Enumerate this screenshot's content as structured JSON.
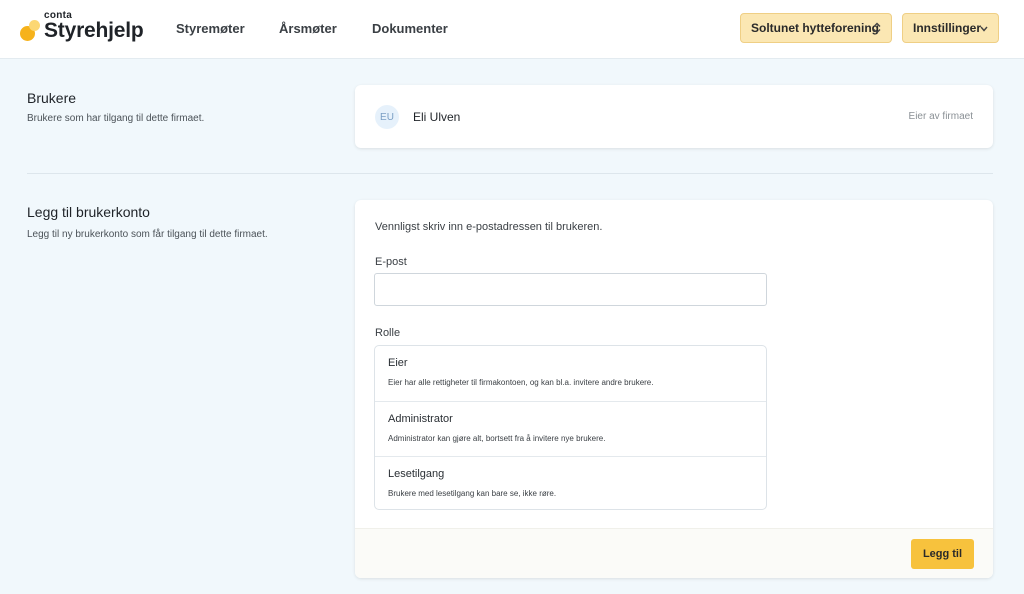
{
  "header": {
    "logo_small": "conta",
    "logo_big": "Styrehjelp",
    "nav": [
      "Styremøter",
      "Årsmøter",
      "Dokumenter"
    ],
    "org_selector": "Soltunet hytteforening",
    "settings_menu": "Innstillinger"
  },
  "users_section": {
    "title": "Brukere",
    "description": "Brukere som har tilgang til dette firmaet.",
    "users": [
      {
        "initials": "EU",
        "name": "Eli Ulven",
        "role": "Eier av firmaet"
      }
    ]
  },
  "add_section": {
    "title": "Legg til brukerkonto",
    "description": "Legg til ny brukerkonto som får tilgang til dette firmaet.",
    "intro": "Vennligst skriv inn e-postadressen til brukeren.",
    "email_label": "E-post",
    "email_value": "",
    "role_label": "Rolle",
    "roles": [
      {
        "title": "Eier",
        "description": "Eier har alle rettigheter til firmakontoen, og kan bl.a. invitere andre brukere."
      },
      {
        "title": "Administrator",
        "description": "Administrator kan gjøre alt, bortsett fra å invitere nye brukere."
      },
      {
        "title": "Lesetilgang",
        "description": "Brukere med lesetilgang kan bare se, ikke røre."
      }
    ],
    "submit_label": "Legg til"
  },
  "colors": {
    "accent": "#f7c23d",
    "accent_light": "#fbe7b3",
    "page_bg": "#f1f8fc"
  },
  "icons": {
    "org_selector": "chevron-up-down-icon",
    "settings_menu": "chevron-down-icon"
  }
}
